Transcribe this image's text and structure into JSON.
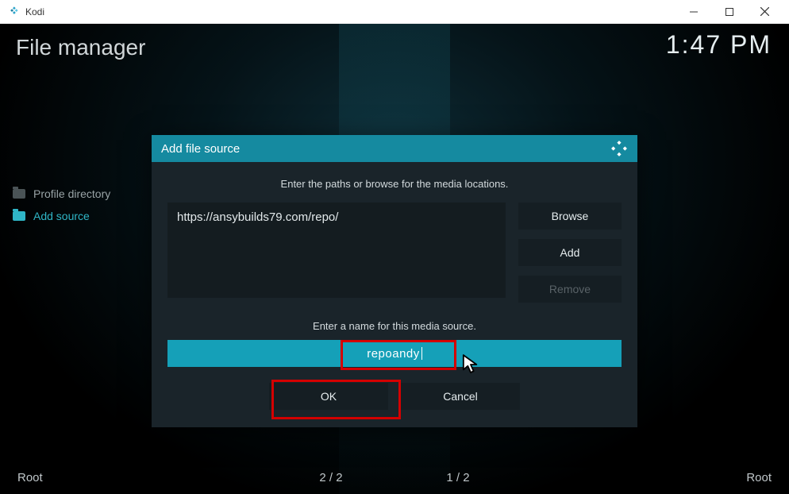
{
  "window": {
    "title": "Kodi"
  },
  "header": {
    "page_title": "File manager",
    "clock": "1:47 PM"
  },
  "sidebar": {
    "items": [
      {
        "label": "Profile directory"
      },
      {
        "label": "Add source"
      }
    ]
  },
  "bottombar": {
    "left_label": "Root",
    "counter_left": "2 / 2",
    "counter_right": "1 / 2",
    "right_label": "Root"
  },
  "dialog": {
    "title": "Add file source",
    "instruction_top": "Enter the paths or browse for the media locations.",
    "path_value": "https://ansybuilds79.com/repo/",
    "buttons": {
      "browse": "Browse",
      "add": "Add",
      "remove": "Remove"
    },
    "instruction_name": "Enter a name for this media source.",
    "name_value": "repoandy",
    "ok": "OK",
    "cancel": "Cancel"
  }
}
